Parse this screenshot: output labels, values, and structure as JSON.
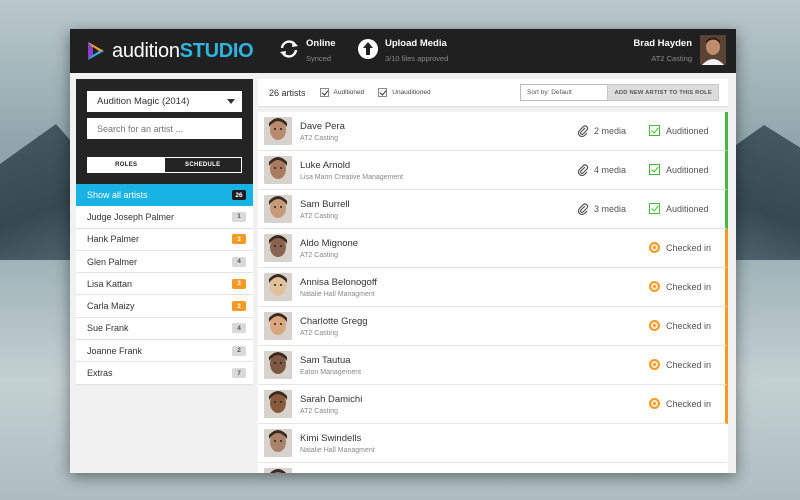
{
  "app": {
    "logo_plain": "audition",
    "logo_bold": "STUDIO"
  },
  "header": {
    "status_title": "Online",
    "status_sub": "Synced",
    "upload_title": "Upload Media",
    "upload_sub": "3/10 files approved",
    "user_name": "Brad Hayden",
    "user_company": "AT2 Casting"
  },
  "sidebar": {
    "project": "Audition Magic (2014)",
    "search_placeholder": "Search for an artist ...",
    "toggle_roles": "ROLES",
    "toggle_schedule": "SCHEDULE",
    "roles": [
      {
        "label": "Show all artists",
        "count": "26",
        "style": "dark",
        "active": true
      },
      {
        "label": "Judge Joseph Palmer",
        "count": "1",
        "style": "grey"
      },
      {
        "label": "Hank Palmer",
        "count": "3",
        "style": "orange"
      },
      {
        "label": "Glen Palmer",
        "count": "4",
        "style": "grey"
      },
      {
        "label": "Lisa Kattan",
        "count": "3",
        "style": "orange"
      },
      {
        "label": "Carla Maizy",
        "count": "2",
        "style": "orange"
      },
      {
        "label": "Sue Frank",
        "count": "4",
        "style": "grey"
      },
      {
        "label": "Joanne Frank",
        "count": "2",
        "style": "grey"
      },
      {
        "label": "Extras",
        "count": "7",
        "style": "grey"
      }
    ]
  },
  "toolbar": {
    "count": "26 artists",
    "filter_auditioned": "Auditioned",
    "filter_unauditioned": "Unauditioned",
    "sort": "Sort by: Default",
    "add_button": "ADD NEW ARTIST TO THIS ROLE"
  },
  "artists": [
    {
      "name": "Dave Pera",
      "agency": "AT2 Casting",
      "media": "2 media",
      "status": "Auditioned",
      "state": "green",
      "skin": "#b98a6c"
    },
    {
      "name": "Luke Arnold",
      "agency": "Lisa Mann Creative Management",
      "media": "4 media",
      "status": "Auditioned",
      "state": "green",
      "skin": "#a97b5f"
    },
    {
      "name": "Sam Burrell",
      "agency": "AT2 Casting",
      "media": "3 media",
      "status": "Auditioned",
      "state": "green",
      "skin": "#c89a7a"
    },
    {
      "name": "Aldo Mignone",
      "agency": "AT2 Casting",
      "media": "",
      "status": "Checked in",
      "state": "orange",
      "skin": "#8a6450"
    },
    {
      "name": "Annisa Belonogoff",
      "agency": "Natalie Hall Managment",
      "media": "",
      "status": "Checked in",
      "state": "orange",
      "skin": "#e2c09a"
    },
    {
      "name": "Charlotte Gregg",
      "agency": "AT2 Casting",
      "media": "",
      "status": "Checked in",
      "state": "orange",
      "skin": "#d9a77c"
    },
    {
      "name": "Sam Tautua",
      "agency": "Eaton Management",
      "media": "",
      "status": "Checked in",
      "state": "orange",
      "skin": "#7d5842"
    },
    {
      "name": "Sarah Damichi",
      "agency": "AT2 Casting",
      "media": "",
      "status": "Checked in",
      "state": "orange",
      "skin": "#8a5a3c"
    },
    {
      "name": "Kimi Swindells",
      "agency": "Natalie Hall Managment",
      "media": "",
      "status": "",
      "state": "none",
      "skin": "#a8826a"
    },
    {
      "name": "",
      "agency": "",
      "media": "",
      "status": "",
      "state": "none",
      "skin": "#9a7a66"
    }
  ],
  "colors": {
    "accent": "#18b2e5",
    "auditioned": "#46b83a",
    "checked_in": "#f59a23",
    "header": "#202020"
  },
  "icons": {
    "sync": "sync-icon",
    "upload": "upload-icon",
    "media": "paperclip-icon",
    "auditioned": "checkbox-icon",
    "checked_in": "target-icon"
  }
}
